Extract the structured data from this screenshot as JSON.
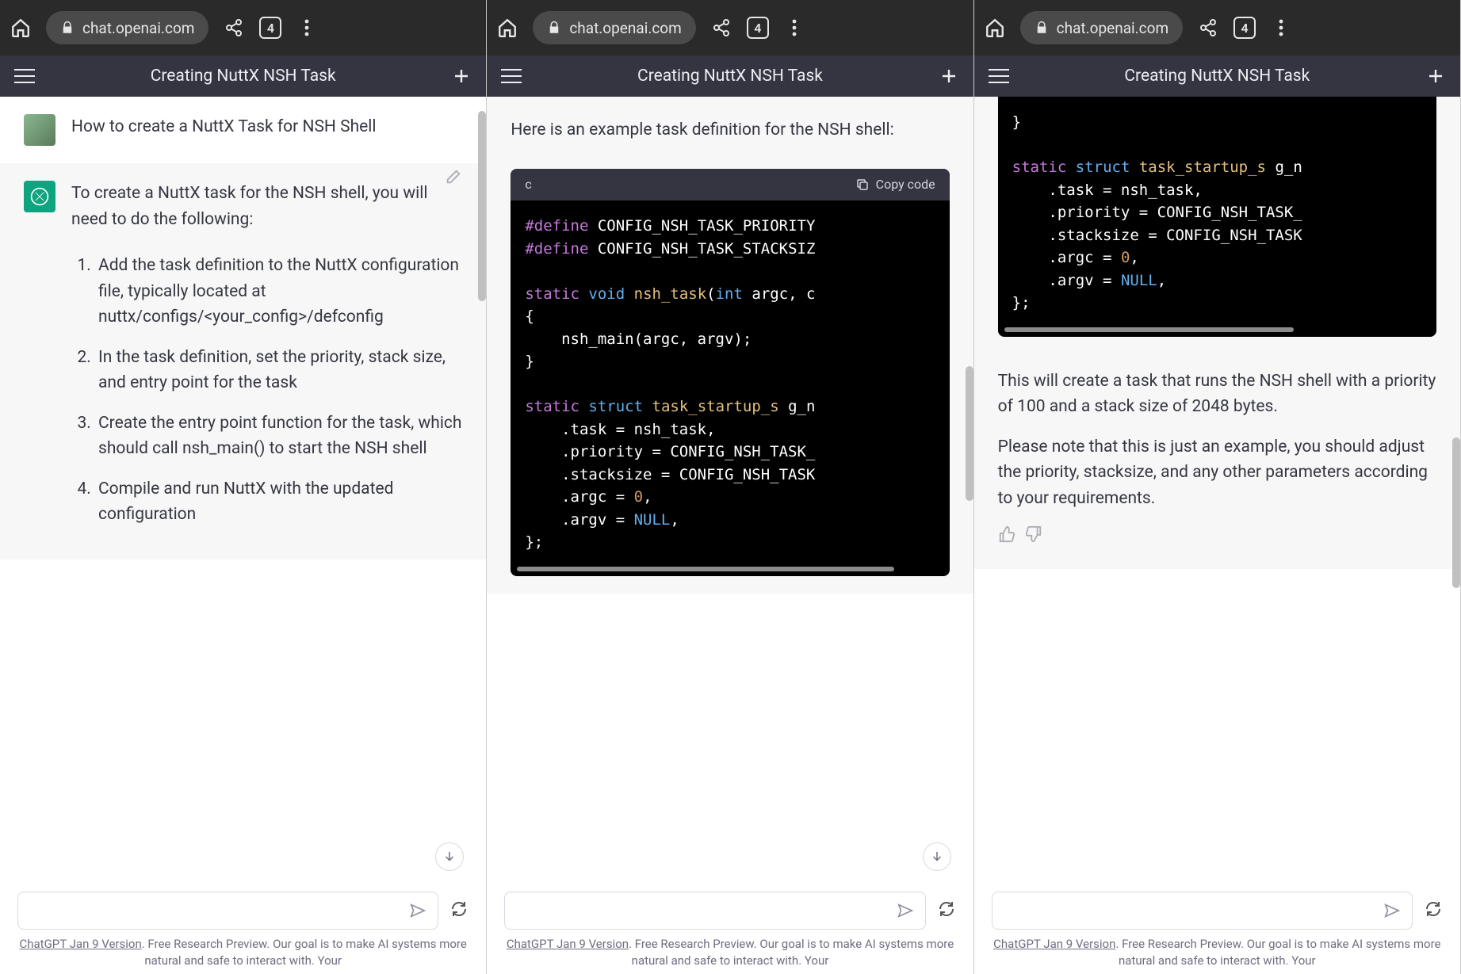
{
  "browser": {
    "url_display": "chat.openai.com",
    "tab_count": "4"
  },
  "page": {
    "title": "Creating NuttX NSH Task"
  },
  "user_message": "How to create a NuttX Task for NSH Shell",
  "panel1": {
    "intro": "To create a NuttX task for the NSH shell, you will need to do the following:",
    "steps": [
      "Add the task definition to the NuttX configuration file, typically located at nuttx/configs/<your_config>/defconfig",
      "In the task definition, set the priority, stack size, and entry point for the task",
      "Create the entry point function for the task, which should call nsh_main() to start the NSH shell",
      "Compile and run NuttX with the updated configuration"
    ]
  },
  "panel2": {
    "prefix_text": "Here is an example task definition for the NSH shell:",
    "code_lang": "c",
    "copy_label": "Copy code"
  },
  "panel3": {
    "p1": "This will create a task that runs the NSH shell with a priority of 100 and a stack size of 2048 bytes.",
    "p2": "Please note that this is just an example, you should adjust the priority, stacksize, and any other parameters according to your requirements."
  },
  "code_constants": {
    "CONFIG_NSH_TASK_PRIORITY": 100,
    "CONFIG_NSH_TASK_STACKSIZE": 2048
  },
  "code_struct_initializer": {
    "task": "nsh_task",
    "priority": "CONFIG_NSH_TASK_",
    "stacksize": "CONFIG_NSH_TASK",
    "argc": 0,
    "argv": "NULL"
  },
  "footer": {
    "version_link": "ChatGPT Jan 9 Version",
    "disclaimer_rest": ". Free Research Preview. Our goal is to make AI systems more natural and safe to interact with. Your"
  }
}
